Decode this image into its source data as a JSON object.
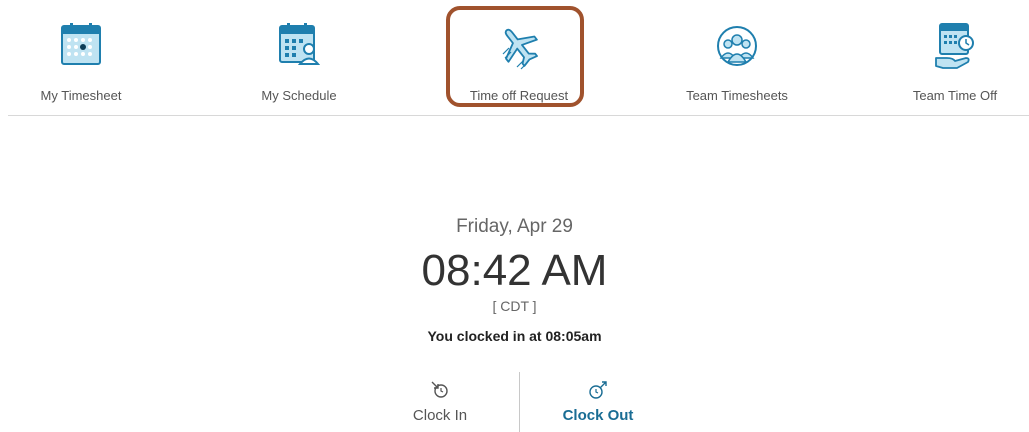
{
  "nav": {
    "items": [
      {
        "label": "My Timesheet",
        "icon": "calendar-icon"
      },
      {
        "label": "My Schedule",
        "icon": "schedule-icon"
      },
      {
        "label": "Time off Request",
        "icon": "airplane-icon"
      },
      {
        "label": "Team Timesheets",
        "icon": "team-icon"
      },
      {
        "label": "Team Time Off",
        "icon": "team-time-off-icon"
      }
    ],
    "highlighted": "Time off Request"
  },
  "clock": {
    "date": "Friday, Apr 29",
    "time": "08:42 AM",
    "timezone": "[ CDT ]",
    "status": "You clocked in at 08:05am",
    "clock_in_label": "Clock In",
    "clock_out_label": "Clock Out"
  },
  "colors": {
    "icon_blue": "#1f7fae",
    "icon_light": "#bfe3f2",
    "highlight": "#a0522d",
    "clock_out": "#1a6d94"
  }
}
